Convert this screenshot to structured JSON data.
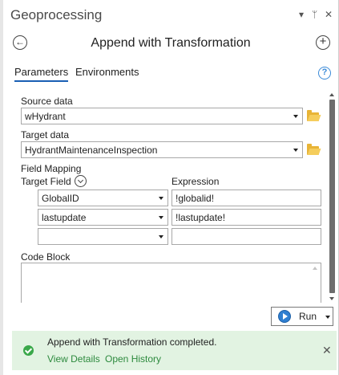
{
  "pane": {
    "title": "Geoprocessing",
    "controls": {
      "menu": "▾",
      "pin": "ᛘ",
      "close": "✕"
    }
  },
  "tool": {
    "back_icon": "arrow-left-circle-icon",
    "title": "Append with Transformation",
    "add_icon": "plus-circle-icon"
  },
  "tabs": [
    {
      "label": "Parameters",
      "active": true
    },
    {
      "label": "Environments",
      "active": false
    }
  ],
  "help": {
    "glyph": "?"
  },
  "params": {
    "source_data": {
      "label": "Source data",
      "value": "wHydrant"
    },
    "target_data": {
      "label": "Target data",
      "value": "HydrantMaintenanceInspection"
    },
    "field_mapping": {
      "label": "Field Mapping",
      "col_target": "Target Field",
      "col_expression": "Expression",
      "rows": [
        {
          "field": "GlobalID",
          "expression": "!globalid!"
        },
        {
          "field": "lastupdate",
          "expression": "!lastupdate!"
        },
        {
          "field": "",
          "expression": ""
        }
      ]
    },
    "code_block": {
      "label": "Code Block",
      "value": ""
    }
  },
  "run": {
    "label": "Run"
  },
  "message": {
    "text": "Append with Transformation completed.",
    "link_details": "View Details",
    "link_history": "Open History",
    "close": "✕",
    "status_color": "#3aa84a",
    "bg_color": "#e2f3e2"
  },
  "colors": {
    "accent": "#1a5fb4",
    "help": "#3a8ad8",
    "folder": "#e8b437"
  }
}
